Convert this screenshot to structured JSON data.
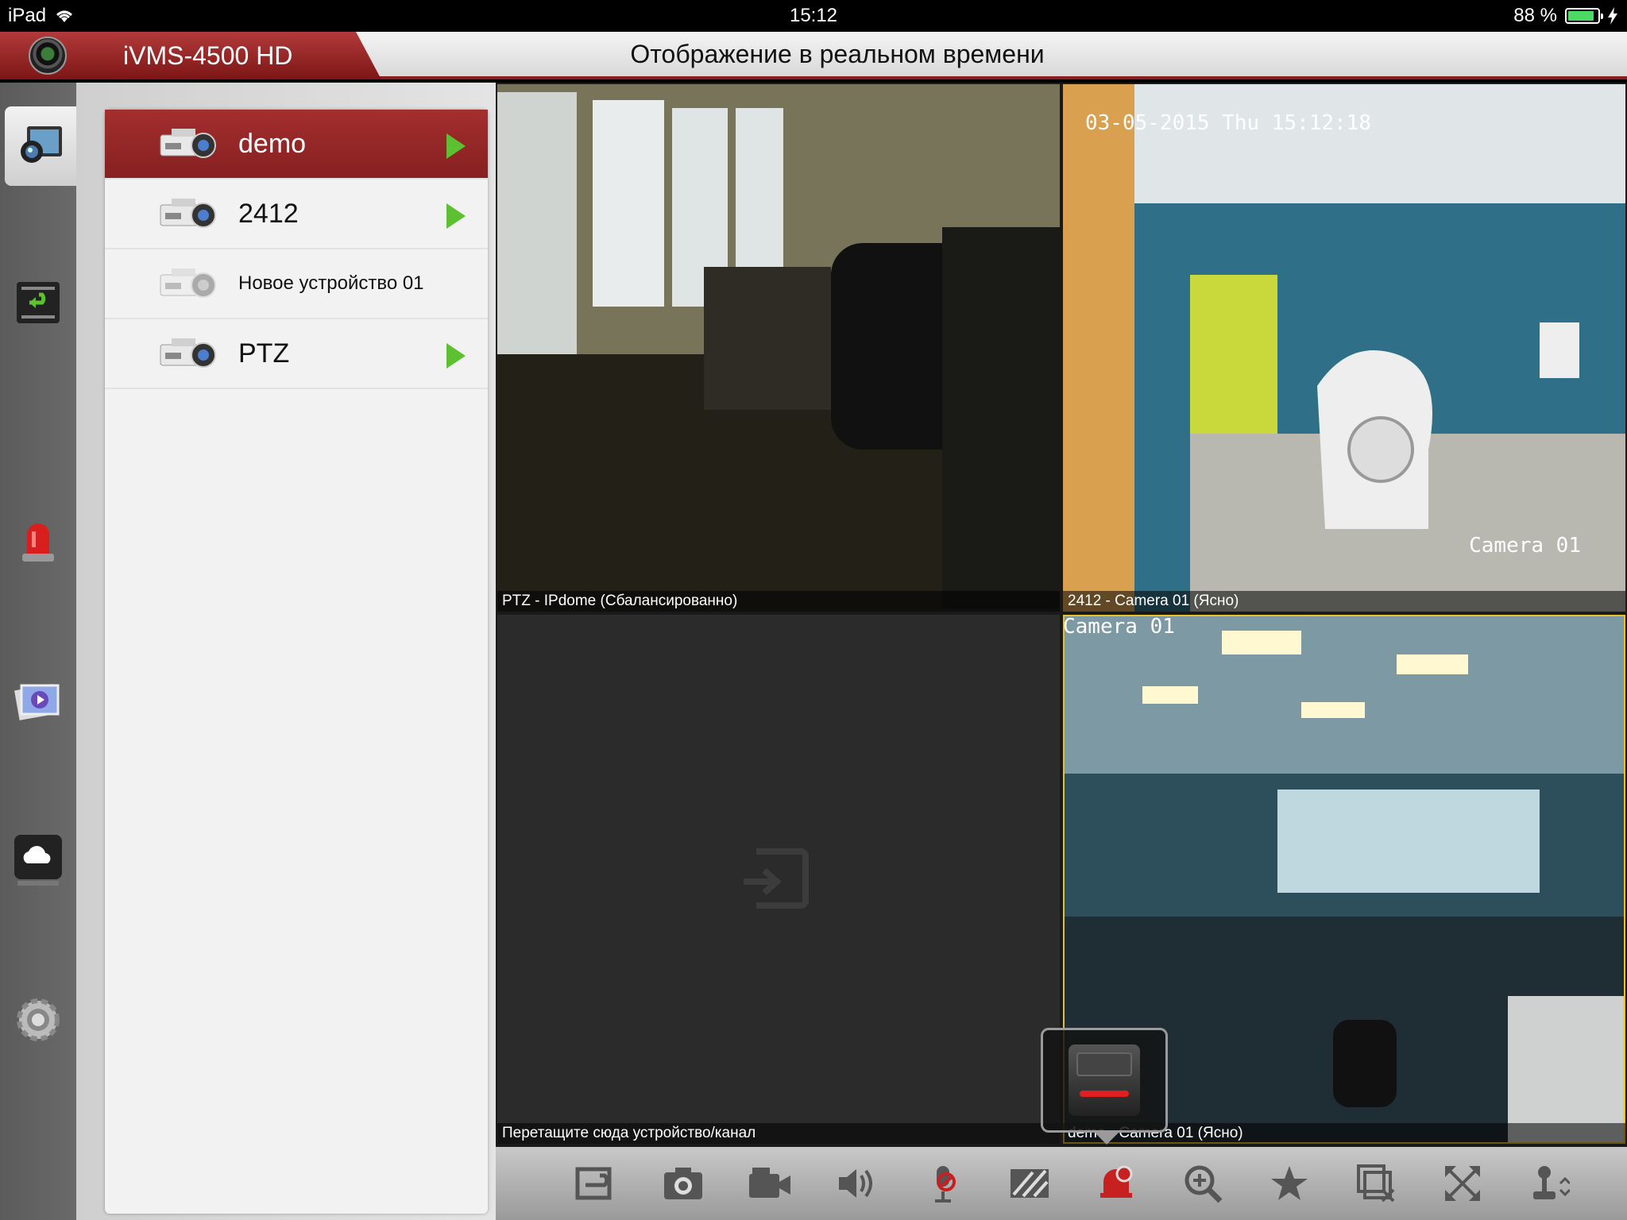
{
  "statusbar": {
    "device": "iPad",
    "time": "15:12",
    "battery": "88 %",
    "battery_fraction": 0.88
  },
  "header": {
    "app_name": "iVMS-4500 HD",
    "page_title": "Отображение в реальном времени"
  },
  "rail": {
    "items": [
      {
        "icon": "live-view-icon",
        "active": true
      },
      {
        "icon": "playback-icon",
        "active": false
      },
      {
        "icon": "alarm-icon",
        "active": false
      },
      {
        "icon": "picture-video-icon",
        "active": false
      },
      {
        "icon": "cloud-icon",
        "active": false
      },
      {
        "icon": "settings-gear-icon",
        "active": false
      }
    ]
  },
  "devices": {
    "items": [
      {
        "name": "demo",
        "selected": true,
        "online": true
      },
      {
        "name": "2412",
        "selected": false,
        "online": true
      },
      {
        "name": "Новое устройство 01",
        "selected": false,
        "online": false
      },
      {
        "name": "PTZ",
        "selected": false,
        "online": true
      }
    ]
  },
  "tiles": [
    {
      "caption": "PTZ - IPdome (Сбалансированно)",
      "osd_top": "",
      "osd_bottom": ""
    },
    {
      "caption": "2412 - Camera 01 (Ясно)",
      "osd_top": "03-05-2015 Thu 15:12:18",
      "osd_bottom": "Camera 01"
    },
    {
      "caption": "Перетащите сюда устройство/канал",
      "osd_top": "",
      "osd_bottom": ""
    },
    {
      "caption": "demo - Camera 01 (Ясно)",
      "osd_top": "Camera 01",
      "osd_bottom": ""
    }
  ],
  "toolbar": {
    "buttons": [
      "playback-return-icon",
      "snapshot-camera-icon",
      "record-video-icon",
      "audio-speaker-icon",
      "microphone-muted-icon",
      "image-quality-icon",
      "alarm-output-bell-icon",
      "digital-zoom-icon",
      "favorite-star-icon",
      "close-all-icon",
      "fullscreen-icon",
      "ptz-joystick-icon"
    ]
  },
  "colors": {
    "accent_red": "#8b1e1e",
    "play_green": "#5cc030",
    "focus_yellow": "#e8c02a"
  }
}
